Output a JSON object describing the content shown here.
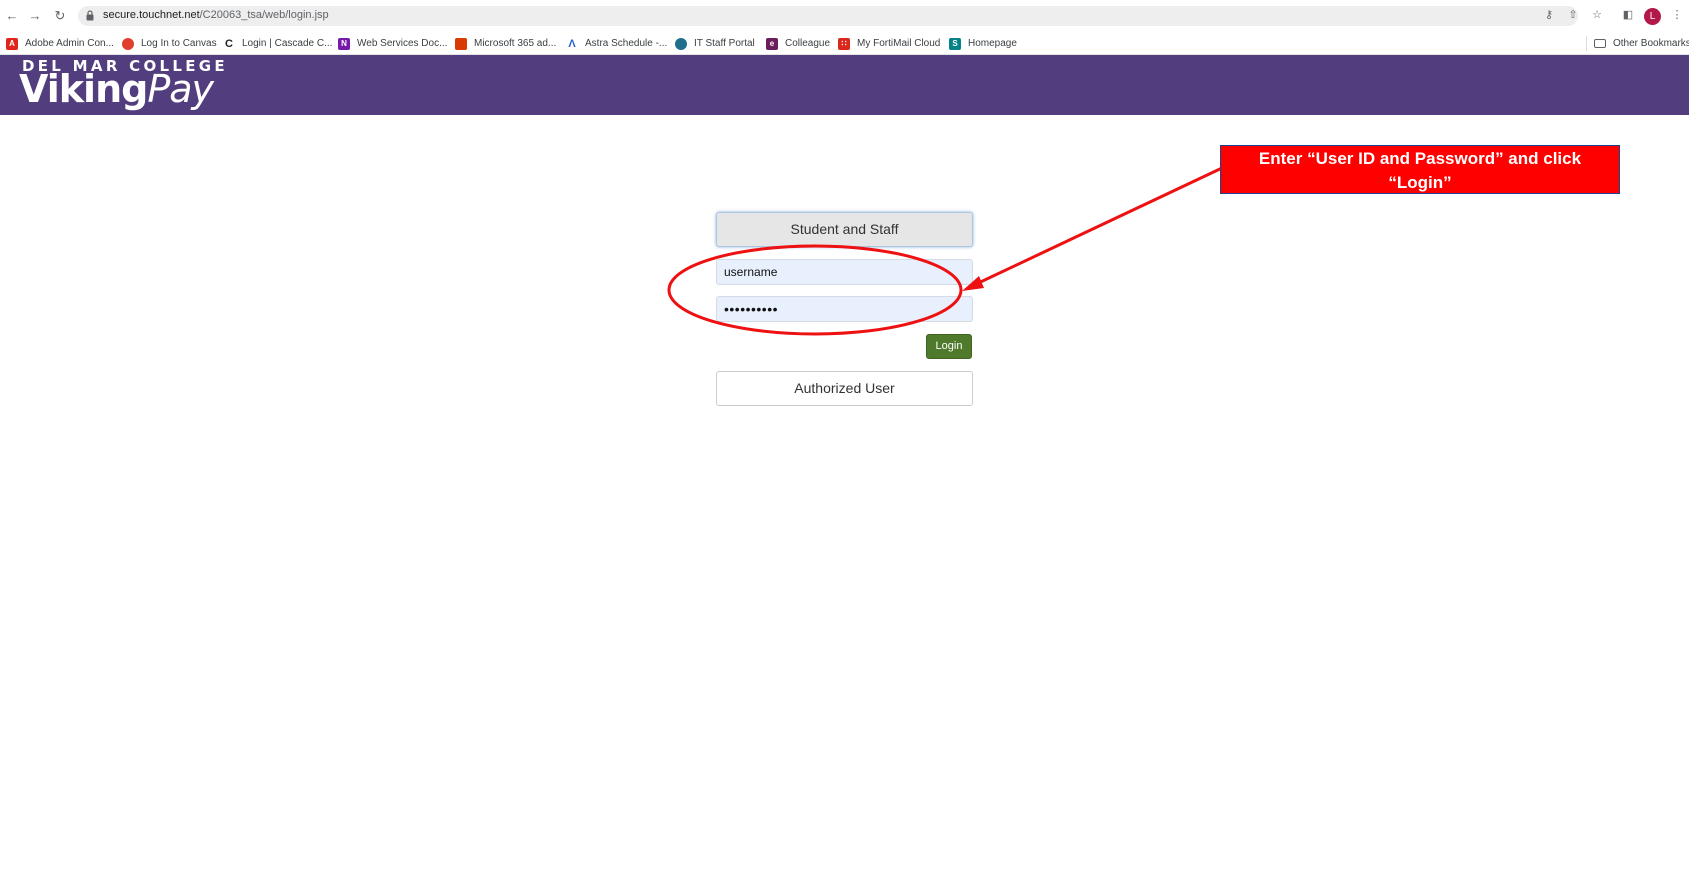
{
  "browser": {
    "url_host": "secure.touchnet.net",
    "url_path": "/C20063_tsa/web/login.jsp",
    "profile_initial": "L",
    "bookmarks": [
      {
        "label": "Adobe Admin Con...",
        "icon": "adobe-icon",
        "color": "#e1251b"
      },
      {
        "label": "Log In to Canvas",
        "icon": "canvas-icon",
        "color": "#e13f2b"
      },
      {
        "label": "Login | Cascade C...",
        "icon": "cascade-icon",
        "color": "#222222"
      },
      {
        "label": "Web Services Doc...",
        "icon": "onenote-icon",
        "color": "#7719aa"
      },
      {
        "label": "Microsoft 365 ad...",
        "icon": "office-icon",
        "color": "#d83b01"
      },
      {
        "label": "Astra Schedule -...",
        "icon": "astra-icon",
        "color": "#2a63c9"
      },
      {
        "label": "IT Staff Portal",
        "icon": "portal-icon",
        "color": "#1f6f8b"
      },
      {
        "label": "Colleague",
        "icon": "colleague-icon",
        "color": "#6b1e5b"
      },
      {
        "label": "My FortiMail Cloud",
        "icon": "fortimail-icon",
        "color": "#da291c"
      },
      {
        "label": "Homepage",
        "icon": "sharepoint-icon",
        "color": "#038387"
      }
    ],
    "other_bookmarks": "Other Bookmarks"
  },
  "header": {
    "college": "DEL MAR COLLEGE",
    "app_name_bold": "Viking",
    "app_name_italic": "Pay",
    "banner_color": "#523e7e"
  },
  "login": {
    "tab_student_staff": "Student and Staff",
    "username_value": "username",
    "password_value": "••••••••••",
    "login_button": "Login",
    "tab_authorized": "Authorized User"
  },
  "annotation": {
    "callout_line1": "Enter “User ID and Password” and click",
    "callout_line2": "“Login”",
    "color": "#fe0000"
  }
}
